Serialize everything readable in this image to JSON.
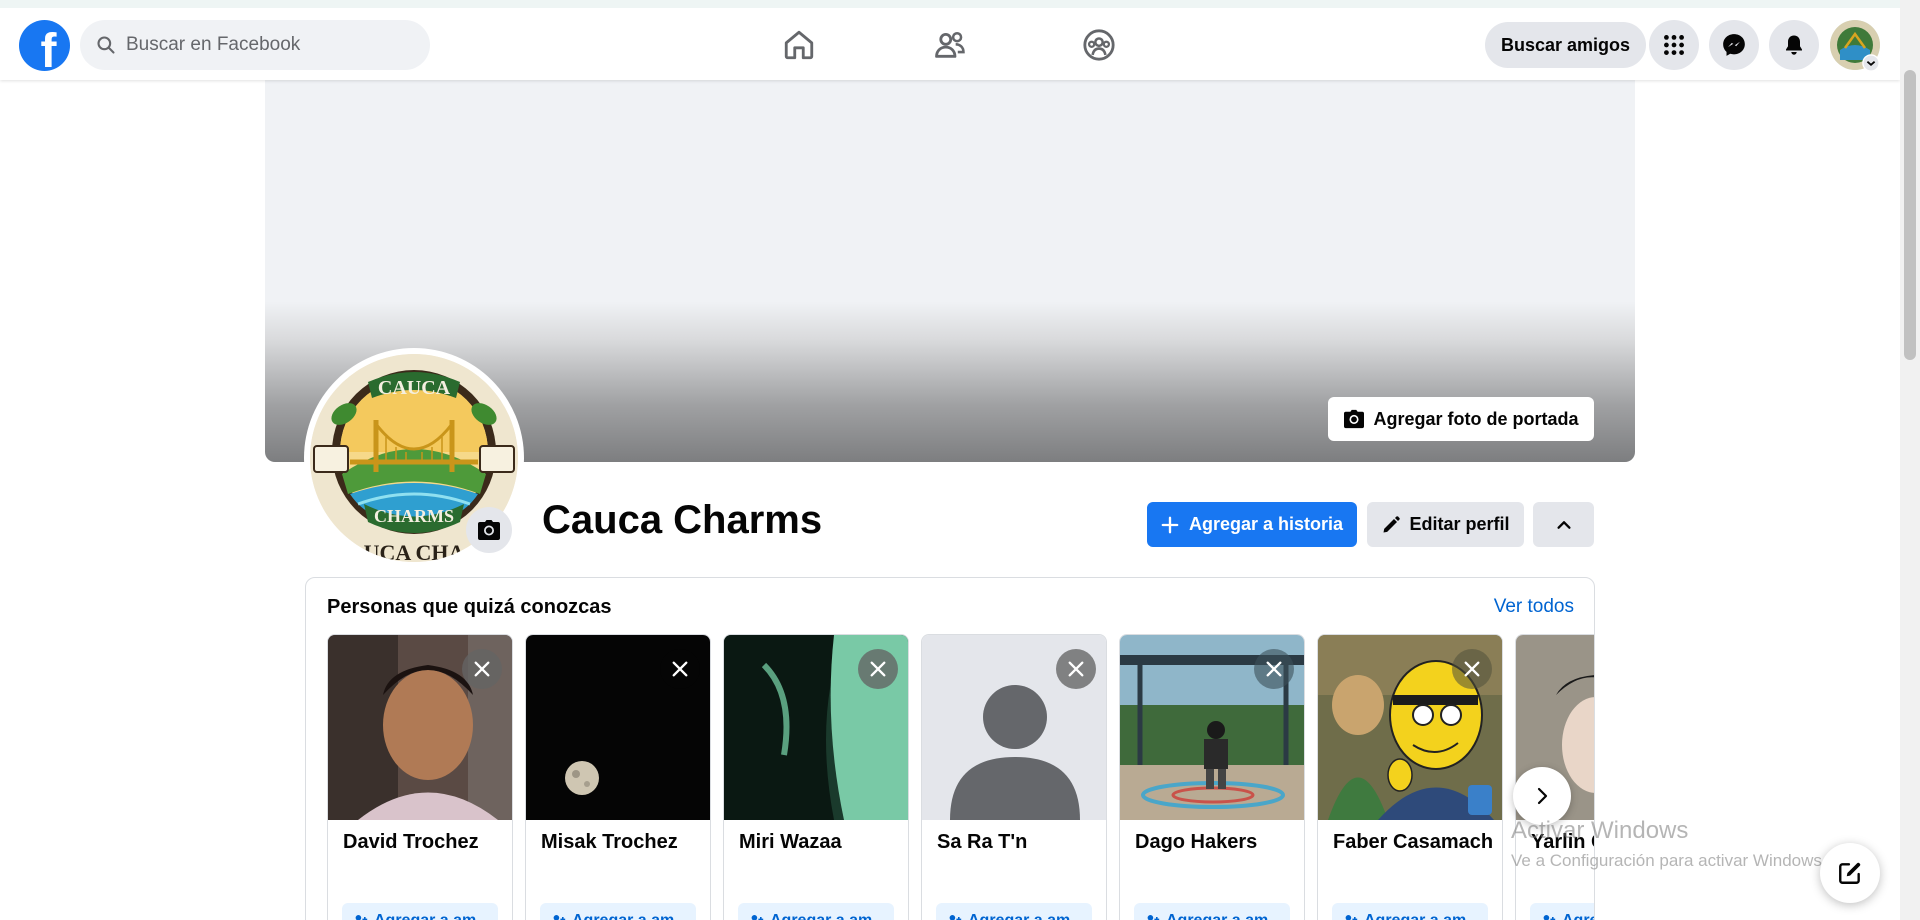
{
  "header": {
    "logo_letter": "f",
    "search_placeholder": "Buscar en Facebook",
    "find_friends_label": "Buscar amigos",
    "nav_icons": [
      "home-icon",
      "friends-icon",
      "groups-icon"
    ],
    "right_icons": [
      "menu-grid-icon",
      "messenger-icon",
      "bell-icon"
    ]
  },
  "cover": {
    "add_cover_label": "Agregar foto de portada"
  },
  "profile": {
    "name": "Cauca Charms",
    "add_story_label": "Agregar a historia",
    "edit_profile_label": "Editar perfil",
    "logo_text_top": "CAUCA",
    "logo_text_bottom": "CHARMS",
    "logo_text_under": "UCA CHA"
  },
  "suggestions": {
    "title": "Personas que quizá conozcas",
    "see_all": "Ver todos",
    "people": [
      {
        "name": "David Trochez",
        "button": "Agregar a am"
      },
      {
        "name": "Misak Trochez",
        "button": "Agregar a am"
      },
      {
        "name": "Miri Wazaa",
        "button": "Agregar a am"
      },
      {
        "name": "Sa Ra T'n",
        "button": "Agregar a am"
      },
      {
        "name": "Dago Hakers",
        "button": "Agregar a am"
      },
      {
        "name": "Faber Casamach",
        "button": "Agregar a am"
      },
      {
        "name": "Yarlin C",
        "button": "Agreg"
      }
    ]
  },
  "watermark": {
    "line1": "Activar Windows",
    "line2": "Ve a Configuración para activar Windows."
  },
  "colors": {
    "brand": "#1877f2",
    "link": "#0064d1",
    "secondary_button": "#e4e6eb"
  }
}
